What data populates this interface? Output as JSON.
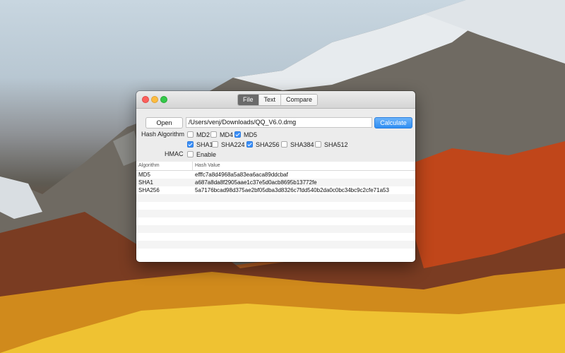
{
  "window": {
    "tabs": [
      {
        "label": "File",
        "active": true
      },
      {
        "label": "Text",
        "active": false
      },
      {
        "label": "Compare",
        "active": false
      }
    ]
  },
  "file_panel": {
    "open_label": "Open",
    "path_value": "/Users/venj/Downloads/QQ_V6.0.dmg",
    "calculate_label": "Calculate",
    "hash_algorithm_label": "Hash Algorithm",
    "algorithms": [
      {
        "label": "MD2",
        "checked": false
      },
      {
        "label": "MD4",
        "checked": false
      },
      {
        "label": "MD5",
        "checked": true
      },
      {
        "label": "SHA1",
        "checked": true
      },
      {
        "label": "SHA224",
        "checked": false
      },
      {
        "label": "SHA256",
        "checked": true
      },
      {
        "label": "SHA384",
        "checked": false
      },
      {
        "label": "SHA512",
        "checked": false
      }
    ],
    "hmac_label": "HMAC",
    "hmac_enable_label": "Enable",
    "hmac_enabled": false
  },
  "results_table": {
    "columns": [
      "Algorithm",
      "Hash Value"
    ],
    "rows": [
      {
        "algorithm": "MD5",
        "hash": "efffc7a8d4968a5a83ea6aca89ddcbaf"
      },
      {
        "algorithm": "SHA1",
        "hash": "a687a8da8f2905aae1c37e5d0acb8695b13772fe"
      },
      {
        "algorithm": "SHA256",
        "hash": "5a7176bcad98d375ae2bf05dba3d8326c7fdd540b2da0c0bc34bc9c2cfe71a53"
      }
    ]
  },
  "colors": {
    "accent": "#3a8ef6",
    "close": "#fc605c",
    "minimize": "#fdbc40",
    "maximize": "#34c84a"
  }
}
